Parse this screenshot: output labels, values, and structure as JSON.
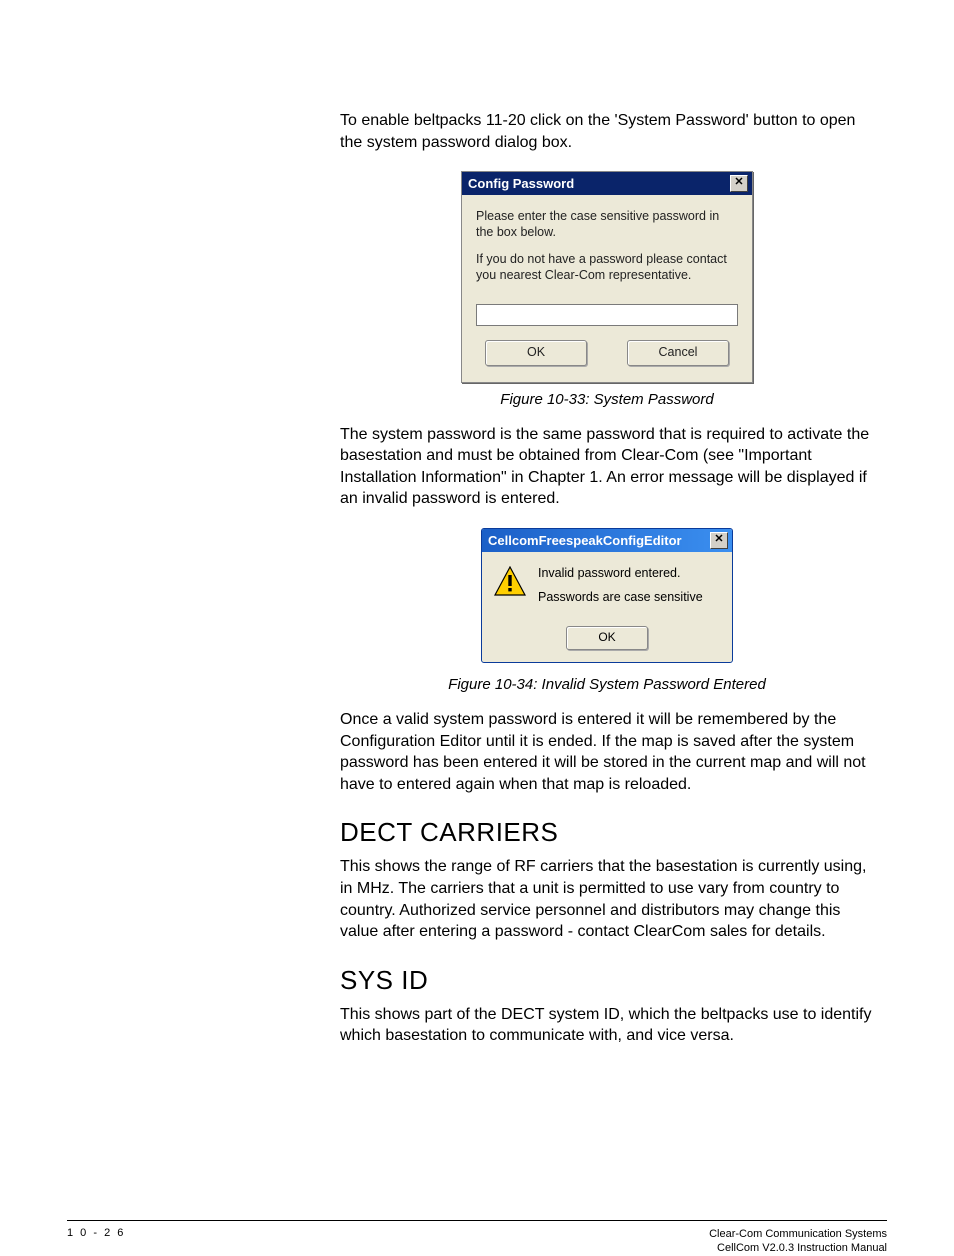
{
  "intro_paragraph": "To enable beltpacks 11-20 click on the 'System Password' button to open the system password dialog box.",
  "dialog1": {
    "title": "Config Password",
    "msg1": "Please enter the case sensitive password in the box below.",
    "msg2": "If you do not have a password please contact you nearest Clear-Com representative.",
    "ok": "OK",
    "cancel": "Cancel"
  },
  "caption1": "Figure 10-33: System Password",
  "para2": "The system password is the same password that is required to activate the basestation and must be obtained from Clear-Com (see \"Important Installation Information\" in Chapter 1.  An error message will be displayed if an invalid password is entered.",
  "dialog2": {
    "title": "CellcomFreespeakConfigEditor",
    "line1": "Invalid password entered.",
    "line2": "Passwords are case sensitive",
    "ok": "OK"
  },
  "caption2": "Figure 10-34: Invalid System Password Entered",
  "para3": "Once a valid system password is entered it will be remembered by the Configuration Editor until it is ended.  If the map is saved after the system password has been entered it will be stored in the current map and will not have to entered again when that map is reloaded.",
  "h_dect": "DECT CARRIERS",
  "para_dect": "This shows the range of RF carriers that the basestation is currently using, in MHz. The carriers that a unit is permitted to use vary from country to country. Authorized service personnel and distributors may change this value after entering a password - contact ClearCom sales for details.",
  "h_sys": "SYS ID",
  "para_sys": "This shows part of the DECT system ID, which the beltpacks use to identify which basestation to communicate with, and vice versa.",
  "footer": {
    "page": "1 0 - 2 6",
    "right1": "Clear-Com Communication Systems",
    "right2": "CellCom V2.0.3 Instruction Manual"
  }
}
